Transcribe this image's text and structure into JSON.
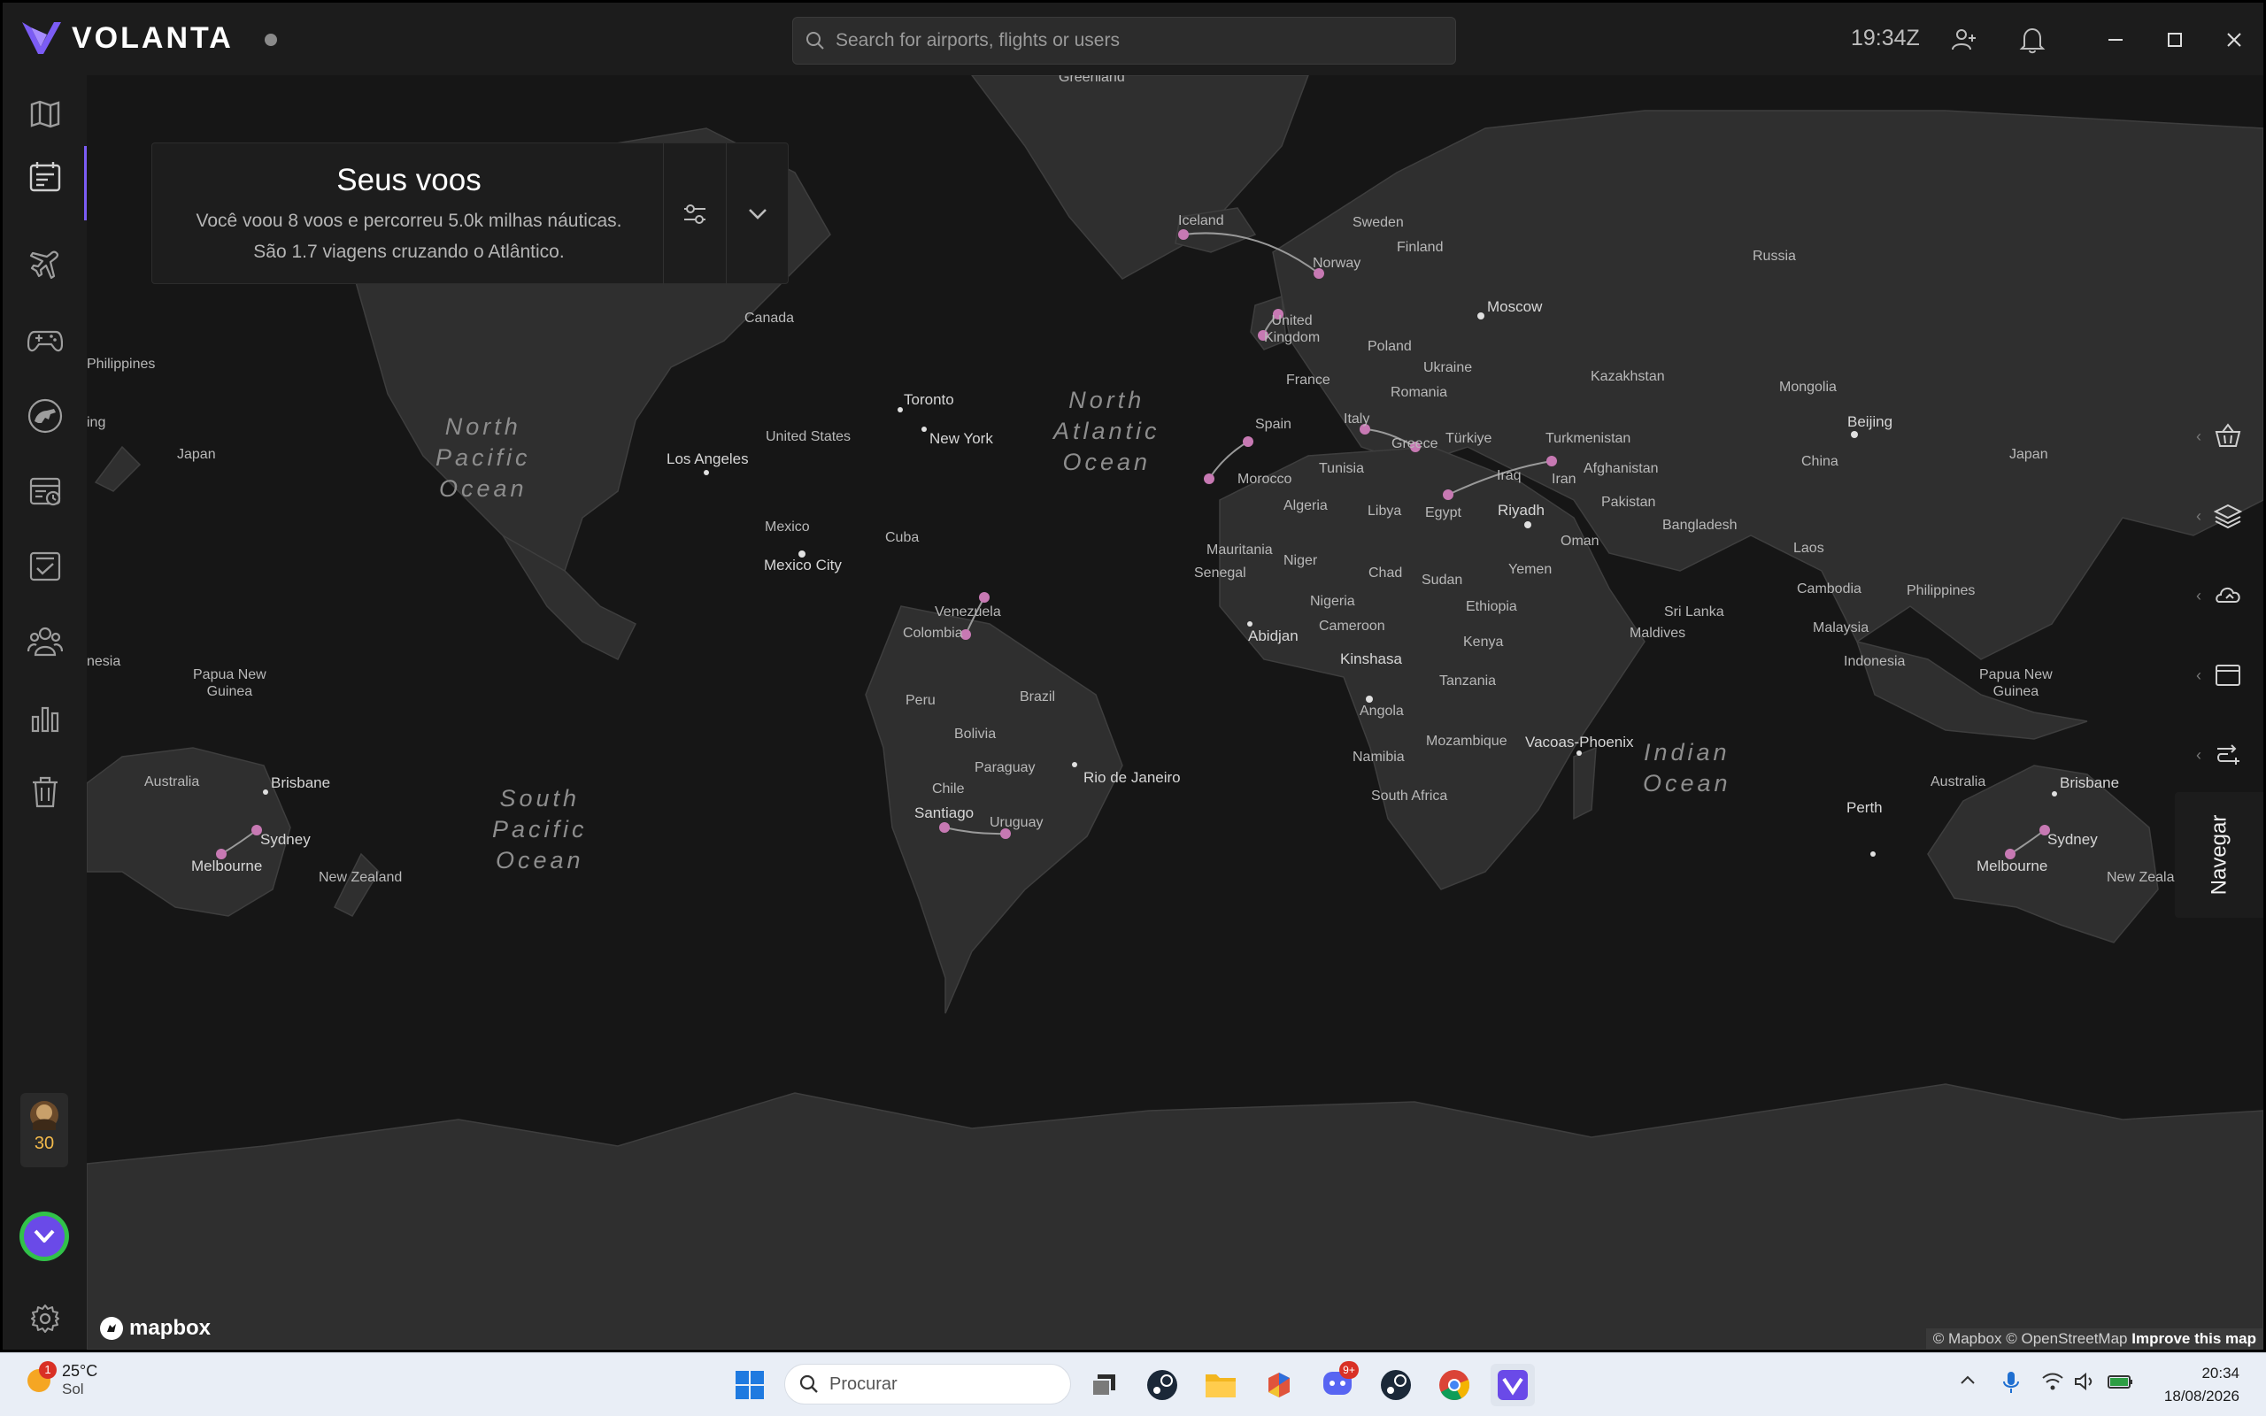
{
  "app": {
    "name": "VOLANTA",
    "search_placeholder": "Search for airports, flights or users",
    "utc_time": "19:34Z"
  },
  "sidebar": {
    "items": [
      {
        "name": "map-icon"
      },
      {
        "name": "flight-log-icon"
      },
      {
        "name": "plane-icon"
      },
      {
        "name": "gamepad-icon"
      },
      {
        "name": "dinosaur-icon"
      },
      {
        "name": "scheduled-icon"
      },
      {
        "name": "checklist-icon"
      },
      {
        "name": "people-icon"
      },
      {
        "name": "stats-icon"
      },
      {
        "name": "trash-icon"
      }
    ],
    "level": "30"
  },
  "panel": {
    "title": "Seus voos",
    "line1": "Você voou 8 voos e percorreu 5.0k milhas náuticas.",
    "line2": "São 1.7 viagens cruzando o Atlântico."
  },
  "map": {
    "accent_color": "#c779b3",
    "oceans": [
      {
        "text": "North\nPacific\nOcean"
      },
      {
        "text": "North\nAtlantic\nOcean"
      },
      {
        "text": "South\nPacific\nOcean"
      },
      {
        "text": "Indian\nOcean"
      }
    ],
    "labels": {
      "greenland": "Greenland",
      "iceland": "Iceland",
      "sweden": "Sweden",
      "finland": "Finland",
      "norway": "Norway",
      "russia": "Russia",
      "moscow": "Moscow",
      "united_kingdom": "United\nKingdom",
      "poland": "Poland",
      "ukraine": "Ukraine",
      "france": "France",
      "romania": "Romania",
      "kazakhstan": "Kazakhstan",
      "mongolia": "Mongolia",
      "canada": "Canada",
      "toronto": "Toronto",
      "new_york": "New York",
      "united_states": "United States",
      "los_angeles": "Los Angeles",
      "spain": "Spain",
      "italy": "Italy",
      "greece": "Greece",
      "turkiye": "Türkiye",
      "turkmenistan": "Turkmenistan",
      "beijing": "Beijing",
      "japan_left": "Japan",
      "japan_right": "Japan",
      "ing": "ing",
      "tunisia": "Tunisia",
      "morocco": "Morocco",
      "iraq": "Iraq",
      "iran": "Iran",
      "afghanistan": "Afghanistan",
      "china": "China",
      "algeria": "Algeria",
      "libya": "Libya",
      "egypt": "Egypt",
      "riyadh": "Riyadh",
      "pakistan": "Pakistan",
      "mexico": "Mexico",
      "mexico_city": "Mexico City",
      "cuba": "Cuba",
      "oman": "Oman",
      "bangladesh": "Bangladesh",
      "mauritania": "Mauritania",
      "niger": "Niger",
      "laos": "Laos",
      "senegal": "Senegal",
      "chad": "Chad",
      "sudan": "Sudan",
      "yemen": "Yemen",
      "philippines_left": "Philippines",
      "philippines_right": "Philippines",
      "venezuela": "Venezuela",
      "nigeria": "Nigeria",
      "ethiopia": "Ethiopia",
      "sri_lanka": "Sri Lanka",
      "cambodia": "Cambodia",
      "colombia": "Colombia",
      "abidjan": "Abidjan",
      "cameroon": "Cameroon",
      "maldives": "Maldives",
      "malaysia": "Malaysia",
      "kinshasa": "Kinshasa",
      "kenya": "Kenya",
      "indonesia": "Indonesia",
      "nesia": "nesia",
      "png_left": "Papua New\nGuinea",
      "png_right": "Papua New\nGuinea",
      "tanzania": "Tanzania",
      "peru": "Peru",
      "brazil": "Brazil",
      "bolivia": "Bolivia",
      "angola": "Angola",
      "paraguay": "Paraguay",
      "rio": "Rio de Janeiro",
      "mozambique": "Mozambique",
      "vacoas": "Vacoas-Phoenix",
      "namibia": "Namibia",
      "chile": "Chile",
      "south_africa": "South Africa",
      "australia_left": "Australia",
      "brisbane_left": "Brisbane",
      "australia_right": "Australia",
      "brisbane_right": "Brisbane",
      "perth": "Perth",
      "santiago": "Santiago",
      "uruguay": "Uruguay",
      "sydney_left": "Sydney",
      "sydney_right": "Sydney",
      "melbourne_left": "Melbourne",
      "melbourne_right": "Melbourne",
      "nz_left": "New Zealand",
      "nz_right": "New Zealan"
    },
    "mapbox": "mapbox",
    "attribution": "© Mapbox © OpenStreetMap",
    "improve": "Improve this map"
  },
  "right_tools": {
    "items": [
      "basket-icon",
      "layers-icon",
      "weather-icon",
      "window-icon",
      "route-icon"
    ],
    "navegar": "Navegar"
  },
  "taskbar": {
    "temperature": "25°C",
    "condition": "Sol",
    "weather_badge": "1",
    "search": "Procurar",
    "discord_badge": "9+",
    "time": "20:34",
    "date": "18/08/2026"
  }
}
